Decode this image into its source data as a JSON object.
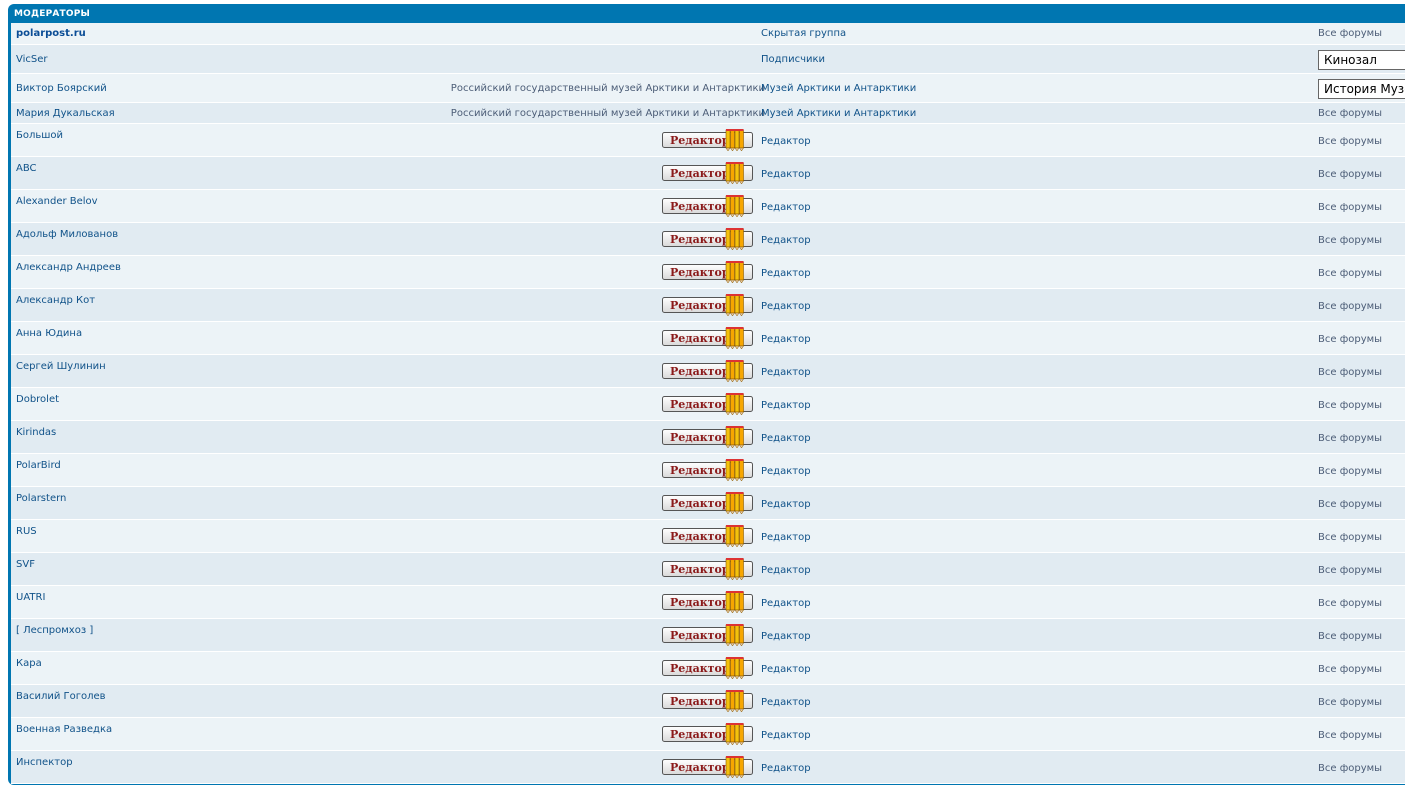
{
  "panel": {
    "header": "МОДЕРАТОРЫ"
  },
  "badge": {
    "label": "Редактор"
  },
  "rows": [
    {
      "name": "polarpost.ru",
      "bold": true,
      "rank": "",
      "group": "Скрытая группа",
      "forums": "Все форумы",
      "forums_type": "text"
    },
    {
      "name": "VicSer",
      "rank": "",
      "group": "Подписчики",
      "forums": "Кинозал",
      "forums_type": "select"
    },
    {
      "name": "Виктор Боярский",
      "rank": "Российский государственный музей Арктики и Антарктики",
      "group": "Музей Арктики и Антарктики",
      "forums": "История Музея",
      "forums_type": "select"
    },
    {
      "name": "Мария Дукальская",
      "rank": "Российский государственный музей Арктики и Антарктики",
      "group": "Музей Арктики и Антарктики",
      "forums": "Все форумы",
      "forums_type": "text"
    },
    {
      "name": "Большой",
      "rank": "badge",
      "group": "Редактор",
      "forums": "Все форумы",
      "forums_type": "text"
    },
    {
      "name": "ABC",
      "rank": "badge",
      "group": "Редактор",
      "forums": "Все форумы",
      "forums_type": "text"
    },
    {
      "name": "Alexander Belov",
      "rank": "badge",
      "group": "Редактор",
      "forums": "Все форумы",
      "forums_type": "text"
    },
    {
      "name": "Адольф Милованов",
      "rank": "badge",
      "group": "Редактор",
      "forums": "Все форумы",
      "forums_type": "text"
    },
    {
      "name": "Александр Андреев",
      "rank": "badge",
      "group": "Редактор",
      "forums": "Все форумы",
      "forums_type": "text"
    },
    {
      "name": "Александр Кот",
      "rank": "badge",
      "group": "Редактор",
      "forums": "Все форумы",
      "forums_type": "text"
    },
    {
      "name": "Анна Юдина",
      "rank": "badge",
      "group": "Редактор",
      "forums": "Все форумы",
      "forums_type": "text"
    },
    {
      "name": "Сергей Шулинин",
      "rank": "badge",
      "group": "Редактор",
      "forums": "Все форумы",
      "forums_type": "text"
    },
    {
      "name": "Dobrolet",
      "rank": "badge",
      "group": "Редактор",
      "forums": "Все форумы",
      "forums_type": "text"
    },
    {
      "name": "Kirindas",
      "rank": "badge",
      "group": "Редактор",
      "forums": "Все форумы",
      "forums_type": "text"
    },
    {
      "name": "PolarBird",
      "rank": "badge",
      "group": "Редактор",
      "forums": "Все форумы",
      "forums_type": "text"
    },
    {
      "name": "Polarstern",
      "rank": "badge",
      "group": "Редактор",
      "forums": "Все форумы",
      "forums_type": "text"
    },
    {
      "name": "RUS",
      "rank": "badge",
      "group": "Редактор",
      "forums": "Все форумы",
      "forums_type": "text"
    },
    {
      "name": "SVF",
      "rank": "badge",
      "group": "Редактор",
      "forums": "Все форумы",
      "forums_type": "text"
    },
    {
      "name": "UATRI",
      "rank": "badge",
      "group": "Редактор",
      "forums": "Все форумы",
      "forums_type": "text"
    },
    {
      "name": "[ Леспромхоз ]",
      "rank": "badge",
      "group": "Редактор",
      "forums": "Все форумы",
      "forums_type": "text"
    },
    {
      "name": "Кара",
      "rank": "badge",
      "group": "Редактор",
      "forums": "Все форумы",
      "forums_type": "text"
    },
    {
      "name": "Василий Гоголев",
      "rank": "badge",
      "group": "Редактор",
      "forums": "Все форумы",
      "forums_type": "text"
    },
    {
      "name": "Военная Разведка",
      "rank": "badge",
      "group": "Редактор",
      "forums": "Все форумы",
      "forums_type": "text"
    },
    {
      "name": "Инспектор",
      "rank": "badge",
      "group": "Редактор",
      "forums": "Все форумы",
      "forums_type": "text"
    }
  ]
}
